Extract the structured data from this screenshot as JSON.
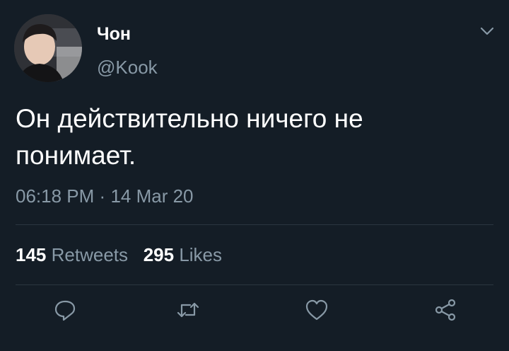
{
  "tweet": {
    "display_name": "Чон",
    "handle": "@Kook",
    "text": "Он действительно ничего не понимает.",
    "time": "06:18 PM",
    "separator": "·",
    "date": "14 Mar 20",
    "retweets_count": "145",
    "retweets_label": "Retweets",
    "likes_count": "295",
    "likes_label": "Likes"
  },
  "icons": {
    "menu": "chevron-down-icon",
    "reply": "reply-icon",
    "retweet": "retweet-icon",
    "like": "heart-icon",
    "share": "share-icon"
  },
  "colors": {
    "background": "#141d26",
    "primary_text": "#ffffff",
    "secondary_text": "#8899a6",
    "divider": "#2b3640"
  }
}
